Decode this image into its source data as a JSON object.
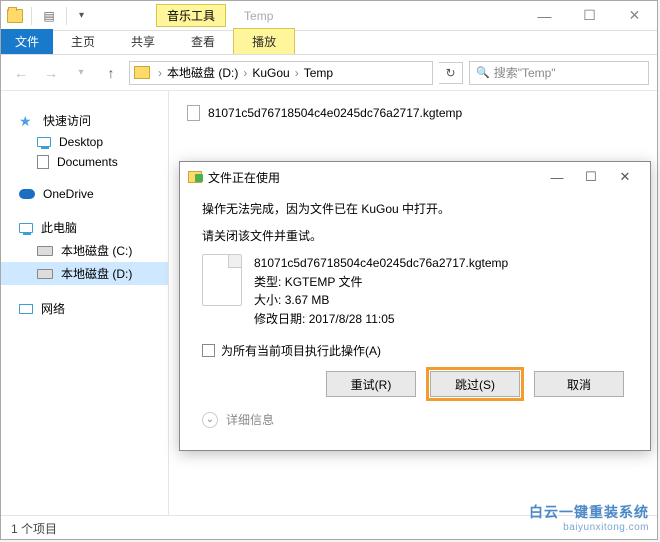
{
  "titlebar": {
    "context_tab": "音乐工具",
    "title": "Temp"
  },
  "ribbon": {
    "file": "文件",
    "tabs": [
      "主页",
      "共享",
      "查看"
    ],
    "context_tab": "播放"
  },
  "address": {
    "crumbs": [
      "本地磁盘 (D:)",
      "KuGou",
      "Temp"
    ],
    "search_placeholder": "搜索\"Temp\""
  },
  "sidebar": {
    "quick_access": "快速访问",
    "desktop": "Desktop",
    "documents": "Documents",
    "onedrive": "OneDrive",
    "this_pc": "此电脑",
    "drive_c": "本地磁盘 (C:)",
    "drive_d": "本地磁盘 (D:)",
    "network": "网络"
  },
  "files": {
    "items": [
      "81071c5d76718504c4e0245dc76a2717.kgtemp"
    ]
  },
  "statusbar": {
    "text": "1 个项目"
  },
  "dialog": {
    "title": "文件正在使用",
    "msg1": "操作无法完成，因为文件已在 KuGou 中打开。",
    "msg2": "请关闭该文件并重试。",
    "file": {
      "name": "81071c5d76718504c4e0245dc76a2717.kgtemp",
      "type_label": "类型:",
      "type_value": "KGTEMP 文件",
      "size_label": "大小:",
      "size_value": "3.67 MB",
      "date_label": "修改日期:",
      "date_value": "2017/8/28 11:05"
    },
    "checkbox_label": "为所有当前项目执行此操作(A)",
    "buttons": {
      "retry": "重试(R)",
      "skip": "跳过(S)",
      "cancel": "取消"
    },
    "more": "详细信息"
  },
  "watermark": {
    "line1": "白云一键重装系统",
    "line2": "baiyunxitong.com"
  }
}
